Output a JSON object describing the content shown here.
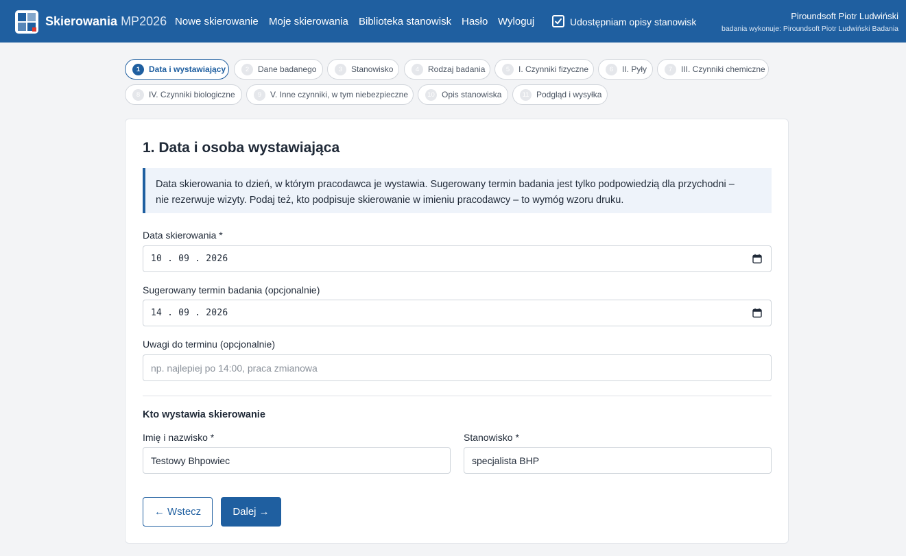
{
  "header": {
    "brand_name": "Skierowania",
    "brand_suffix": "MP2026",
    "nav": [
      "Nowe skierowanie",
      "Moje skierowania",
      "Biblioteka stanowisk",
      "Hasło",
      "Wyloguj"
    ],
    "share_label": "Udostępniam opisy stanowisk",
    "share_checked": true,
    "user_name": "Piroundsoft Piotr Ludwiński",
    "user_sub": "badania wykonuje: Piroundsoft Piotr Ludwiński Badania"
  },
  "steps": [
    {
      "num": "1",
      "label": "Data i wystawiający",
      "active": true
    },
    {
      "num": "2",
      "label": "Dane badanego"
    },
    {
      "num": "3",
      "label": "Stanowisko"
    },
    {
      "num": "4",
      "label": "Rodzaj badania"
    },
    {
      "num": "5",
      "label": "I. Czynniki fizyczne"
    },
    {
      "num": "6",
      "label": "II. Pyły"
    },
    {
      "num": "7",
      "label": "III. Czynniki chemiczne"
    },
    {
      "num": "8",
      "label": "IV. Czynniki biologiczne"
    },
    {
      "num": "9",
      "label": "V. Inne czynniki, w tym niebezpieczne"
    },
    {
      "num": "10",
      "label": "Opis stanowiska"
    },
    {
      "num": "11",
      "label": "Podgląd i wysyłka"
    }
  ],
  "form": {
    "title": "1. Data i osoba wystawiająca",
    "info_line1": "Data skierowania to dzień, w którym pracodawca je wystawia. Sugerowany termin badania jest tylko podpowiedzią dla przychodni –",
    "info_line2": "nie rezerwuje wizyty. Podaj też, kto podpisuje skierowanie w imieniu pracodawcy – to wymóg wzoru druku.",
    "date_label": "Data skierowania *",
    "date_value": "10 . 09 . 2026",
    "suggested_label": "Sugerowany termin badania (opcjonalnie)",
    "suggested_value": "14 . 09 . 2026",
    "notes_label": "Uwagi do terminu (opcjonalnie)",
    "notes_placeholder": "np. najlepiej po 14:00, praca zmianowa",
    "notes_value": "",
    "issuer_section": "Kto wystawia skierowanie",
    "name_label": "Imię i nazwisko *",
    "name_value": "Testowy Bhpowiec",
    "position_label": "Stanowisko *",
    "position_value": "specjalista BHP",
    "back_button": "← Wstecz",
    "next_button": "Dalej →"
  },
  "colors": {
    "primary": "#1f5fa0",
    "info_bg": "#eef3fa",
    "page_bg": "#f3f4f6"
  },
  "icons": {
    "logo": "app-logo",
    "calendar": "calendar-icon",
    "checkbox": "checkbox-checked-icon"
  }
}
